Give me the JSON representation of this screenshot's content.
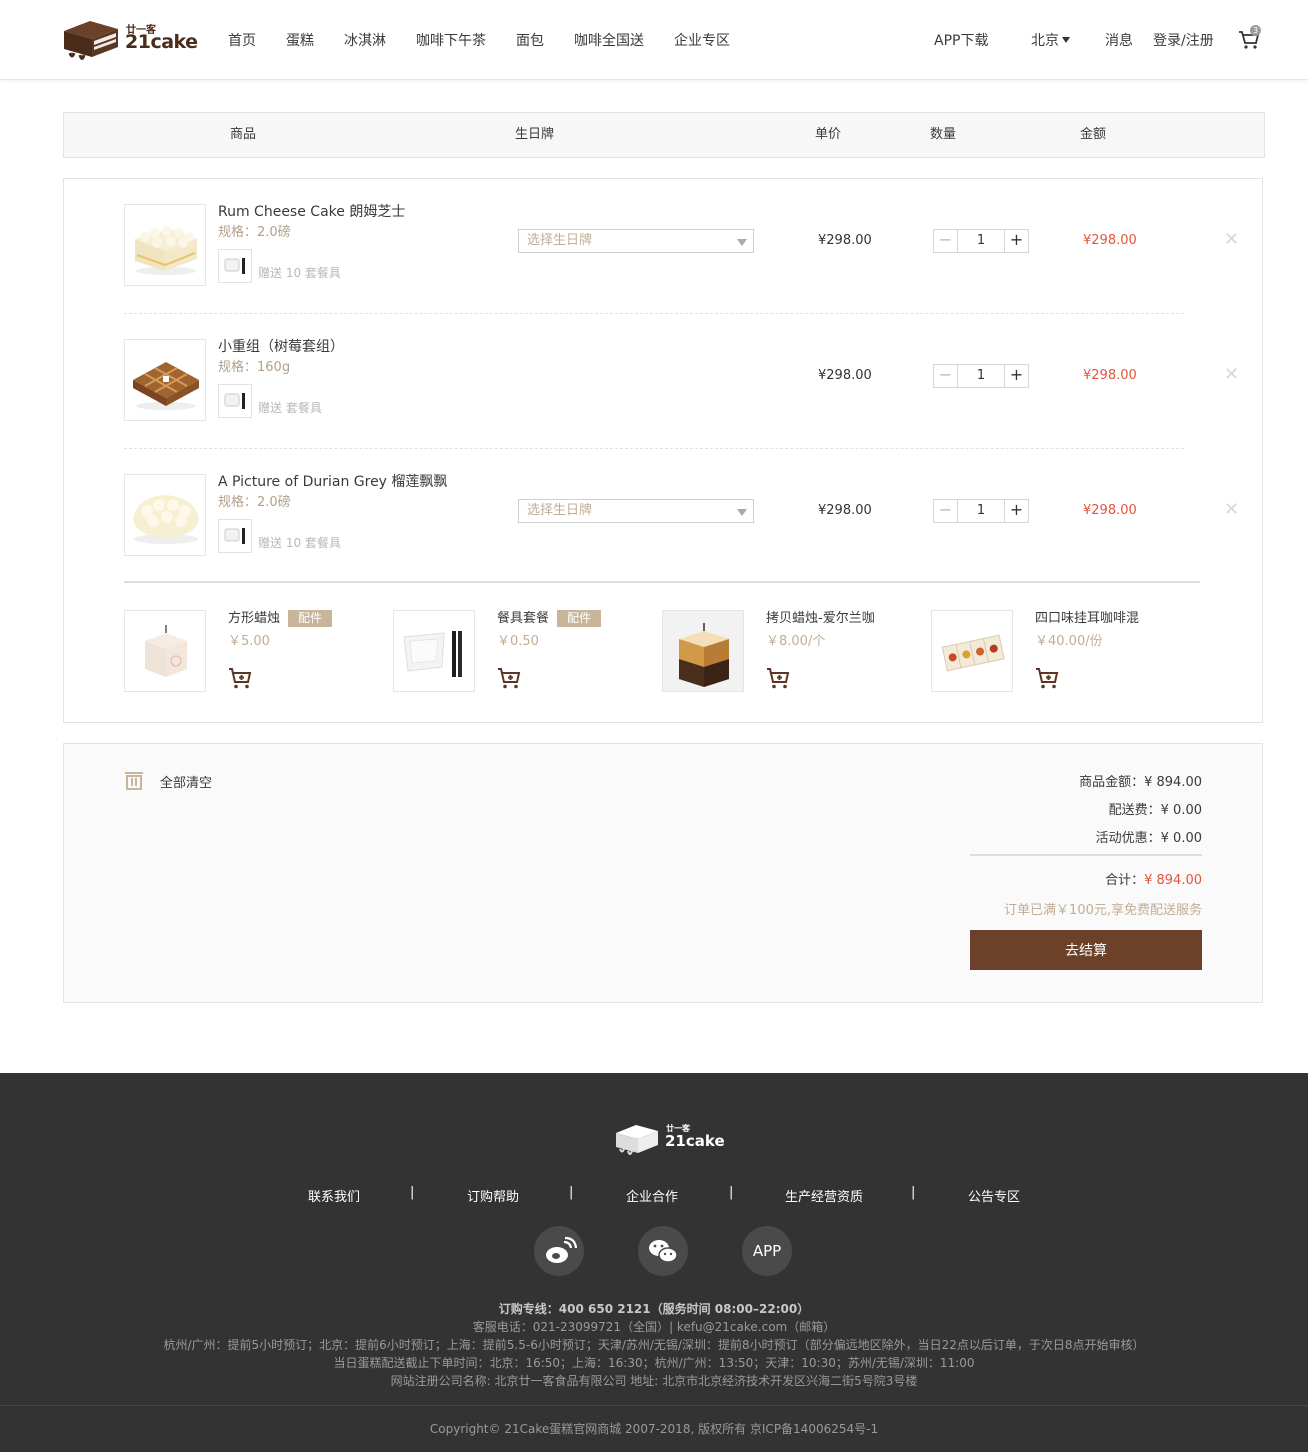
{
  "header": {
    "logo_text": "21cake",
    "logo_subtext": "廿一客",
    "nav": [
      "首页",
      "蛋糕",
      "冰淇淋",
      "咖啡下午茶",
      "面包",
      "咖啡全国送",
      "企业专区"
    ],
    "app_download": "APP下载",
    "city": "北京",
    "messages": "消息",
    "login": "登录/注册",
    "cart_count": "3"
  },
  "table_head": {
    "product": "商品",
    "birthday_card": "生日牌",
    "unit_price": "单价",
    "quantity": "数量",
    "amount": "金额"
  },
  "cart_items": [
    {
      "name": "Rum Cheese Cake 朗姆芝士",
      "spec": "规格：2.0磅",
      "gift": "赠送 10 套餐具",
      "birthday_placeholder": "选择生日牌",
      "has_birthday_select": true,
      "price": "¥298.00",
      "qty": "1",
      "amount": "¥298.00"
    },
    {
      "name": "小重组（树莓套组）",
      "spec": "规格：160g",
      "gift": "赠送  套餐具",
      "birthday_placeholder": "",
      "has_birthday_select": false,
      "price": "¥298.00",
      "qty": "1",
      "amount": "¥298.00"
    },
    {
      "name": "A Picture of Durian Grey 榴莲飘飘",
      "spec": "规格：2.0磅",
      "gift": "赠送 10 套餐具",
      "birthday_placeholder": "选择生日牌",
      "has_birthday_select": true,
      "price": "¥298.00",
      "qty": "1",
      "amount": "¥298.00"
    }
  ],
  "accessories": [
    {
      "name": "方形蜡烛",
      "tag": "配件",
      "price": "￥5.00"
    },
    {
      "name": "餐具套餐",
      "tag": "配件",
      "price": "￥0.50"
    },
    {
      "name": "拷贝蜡烛-爱尔兰咖",
      "tag": "",
      "price": "￥8.00/个"
    },
    {
      "name": "四口味挂耳咖啡混",
      "tag": "",
      "price": "￥40.00/份"
    }
  ],
  "summary": {
    "clear_all": "全部清空",
    "goods_amount_label": "商品金额：",
    "goods_amount": "¥ 894.00",
    "shipping_label": "配送费：",
    "shipping": "¥ 0.00",
    "discount_label": "活动优惠：",
    "discount": "¥ 0.00",
    "total_label": "合计：",
    "total": "¥ 894.00",
    "free_shipping_note": "订单已满￥100元,享免费配送服务",
    "checkout": "去结算"
  },
  "footer": {
    "links": [
      "联系我们",
      "订购帮助",
      "企业合作",
      "生产经营资质",
      "公告专区"
    ],
    "separator": "|",
    "app_label": "APP",
    "hotline": "订购专线：400 650 2121（服务时间 08:00–22:00）",
    "service": "客服电话：021-23099721（全国）| kefu@21cake.com（邮箱）",
    "order_advance": "杭州/广州：提前5小时预订；北京：提前6小时预订；上海：提前5.5-6小时预订；天津/苏州/无锡/深圳：提前8小时预订（部分偏远地区除外，当日22点以后订单，于次日8点开始审核）",
    "same_day": "当日蛋糕配送截止下单时间：北京：16:50；上海：16:30；杭州/广州：13:50；天津：10:30；苏州/无锡/深圳：11:00",
    "company": "网站注册公司名称: 北京廿一客食品有限公司 地址: 北京市北京经济技术开发区兴海二街5号院3号楼",
    "copyright": "Copyright© 21Cake蛋糕官网商城 2007-2018, 版权所有 京ICP备14006254号-1"
  },
  "colors": {
    "brand_brown": "#6b4129",
    "price_red": "#e4563b",
    "accent_tan": "#c1ad96",
    "footer_bg": "#333333"
  }
}
